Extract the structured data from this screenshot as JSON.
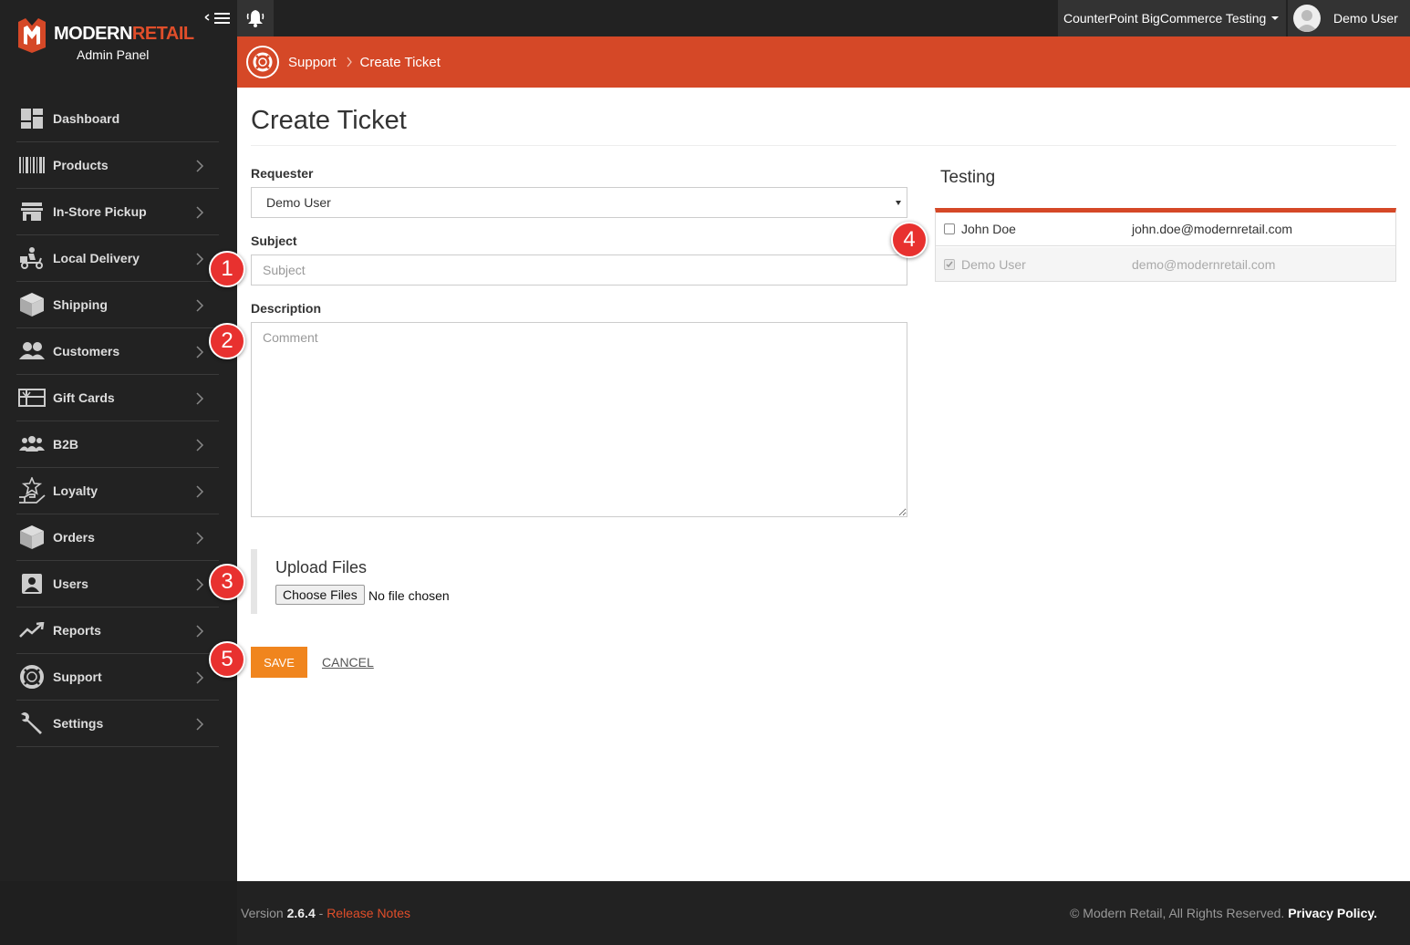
{
  "brand": {
    "name_a": "MODERN",
    "name_b": "RETAIL",
    "subtitle": "Admin Panel"
  },
  "topbar": {
    "store": "CounterPoint BigCommerce Testing",
    "user": "Demo User"
  },
  "breadcrumb": {
    "parent": "Support",
    "current": "Create Ticket"
  },
  "sidebar": {
    "items": [
      {
        "label": "Dashboard",
        "icon": "dashboard-icon"
      },
      {
        "label": "Products",
        "icon": "barcode-icon"
      },
      {
        "label": "In-Store Pickup",
        "icon": "store-icon"
      },
      {
        "label": "Local Delivery",
        "icon": "delivery-scooter-icon"
      },
      {
        "label": "Shipping",
        "icon": "box-icon"
      },
      {
        "label": "Customers",
        "icon": "customers-icon"
      },
      {
        "label": "Gift Cards",
        "icon": "gift-card-icon"
      },
      {
        "label": "B2B",
        "icon": "group-icon"
      },
      {
        "label": "Loyalty",
        "icon": "loyalty-hand-star-icon"
      },
      {
        "label": "Orders",
        "icon": "box-icon"
      },
      {
        "label": "Users",
        "icon": "user-card-icon"
      },
      {
        "label": "Reports",
        "icon": "trend-chart-icon"
      },
      {
        "label": "Support",
        "icon": "lifebuoy-icon"
      },
      {
        "label": "Settings",
        "icon": "wrench-icon"
      }
    ]
  },
  "form": {
    "title": "Create Ticket",
    "requester_label": "Requester",
    "requester_value": "Demo User",
    "subject_label": "Subject",
    "subject_placeholder": "Subject",
    "description_label": "Description",
    "description_placeholder": "Comment",
    "upload_title": "Upload Files",
    "choose_files": "Choose Files",
    "no_file": "No file chosen",
    "save": "SAVE",
    "cancel": "CANCEL"
  },
  "team": {
    "name": "Testing",
    "members": [
      {
        "name": "John Doe",
        "email": "john.doe@modernretail.com",
        "checked": false,
        "disabled": false
      },
      {
        "name": "Demo User",
        "email": "demo@modernretail.com",
        "checked": true,
        "disabled": true
      }
    ]
  },
  "callouts": [
    "1",
    "2",
    "3",
    "4",
    "5"
  ],
  "footer": {
    "version_label": "Version",
    "version": "2.6.4",
    "separator": " - ",
    "release_notes": "Release Notes",
    "copyright": "© Modern Retail, All Rights Reserved.",
    "privacy": "Privacy Policy."
  },
  "colors": {
    "accent": "#d54827",
    "save": "#f0851e",
    "callout": "#e8312f",
    "sidebar": "#222222"
  }
}
